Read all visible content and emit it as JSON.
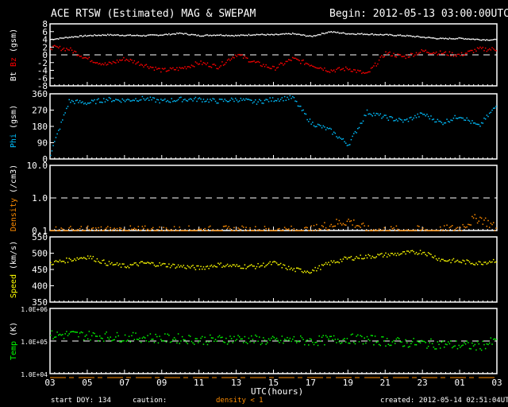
{
  "header": {
    "title": "ACE RTSW (Estimated) MAG & SWEPAM",
    "begin": "Begin: 2012-05-13 03:00:00UTC"
  },
  "footer": {
    "start_doy": "start DOY: 134",
    "caution": "caution:",
    "density_note": "density < 1",
    "created": "created: 2012-05-14 02:51:04UTC",
    "xlabel": "UTC(hours)"
  },
  "colors": {
    "bt": "#ffffff",
    "bz": "#ff0000",
    "phi": "#00bfff",
    "density": "#ff8c00",
    "speed": "#ffff00",
    "temp": "#00ff00"
  },
  "chart_data": {
    "type": "scatter",
    "x_hours_from_start": [
      0,
      1,
      2,
      3,
      4,
      5,
      6,
      7,
      8,
      9,
      10,
      11,
      12,
      13,
      14,
      15,
      16,
      17,
      18,
      19,
      20,
      21,
      22,
      23,
      24
    ],
    "xticks": [
      "03",
      "05",
      "07",
      "09",
      "11",
      "13",
      "15",
      "17",
      "19",
      "21",
      "23",
      "01",
      "03"
    ],
    "panels": [
      {
        "name": "bt-bz",
        "ylabel_parts": [
          "Bt",
          "Bz",
          "(gsm)"
        ],
        "ylim": [
          -8,
          8
        ],
        "scale": "linear",
        "yticks": [
          "8",
          "6",
          "4",
          "2",
          "0",
          "-2",
          "-4",
          "-6",
          "-8"
        ],
        "reference": 0,
        "series": [
          {
            "name": "Bt",
            "color": "#ffffff",
            "values": [
              4,
              4.6,
              5,
              5.2,
              5.1,
              5,
              5.2,
              5.6,
              5,
              5.2,
              5,
              5.3,
              5.2,
              5.5,
              4.8,
              6,
              5.5,
              5.4,
              5.2,
              5,
              4.6,
              4.2,
              4.3,
              4,
              3.9
            ]
          },
          {
            "name": "Bz",
            "color": "#ff0000",
            "values": [
              2,
              1.5,
              -1,
              -2.5,
              -1,
              -2.5,
              -4,
              -3.5,
              -2,
              -3,
              0.2,
              -2,
              -3.5,
              -1,
              -2.5,
              -4,
              -3.5,
              -5,
              0.5,
              -0.5,
              1,
              0.5,
              0,
              1.5,
              1.5
            ]
          }
        ]
      },
      {
        "name": "phi",
        "ylabel_parts": [
          "Phi",
          "(gsm)"
        ],
        "ylim": [
          0,
          360
        ],
        "scale": "linear",
        "yticks": [
          "360",
          "270",
          "180",
          "90",
          "0"
        ],
        "series": [
          {
            "name": "Phi",
            "color": "#00bfff",
            "values": [
              30,
              320,
              310,
              330,
              325,
              335,
              320,
              330,
              330,
              320,
              330,
              315,
              330,
              340,
              200,
              160,
              80,
              260,
              230,
              210,
              250,
              200,
              240,
              180,
              300
            ]
          }
        ]
      },
      {
        "name": "density",
        "ylabel_parts": [
          "Density",
          "(/cm3)"
        ],
        "ylim": [
          0.1,
          10
        ],
        "scale": "log",
        "yticks": [
          "10.0",
          "1.0",
          "0.1"
        ],
        "reference": 1,
        "series": [
          {
            "name": "Density",
            "color": "#ff8c00",
            "values": [
              0.1,
              0.1,
              0.1,
              0.1,
              0.1,
              0.1,
              0.1,
              0.1,
              0.1,
              0.1,
              0.1,
              0.1,
              0.1,
              0.1,
              0.1,
              0.15,
              0.2,
              0.1,
              0.1,
              0.1,
              0.1,
              0.1,
              0.12,
              0.25,
              0.1
            ]
          }
        ]
      },
      {
        "name": "speed",
        "ylabel_parts": [
          "Speed",
          "(km/s)"
        ],
        "ylim": [
          350,
          550
        ],
        "scale": "linear",
        "yticks": [
          "550",
          "500",
          "450",
          "400",
          "350"
        ],
        "series": [
          {
            "name": "Speed",
            "color": "#ffff00",
            "values": [
              470,
              480,
              490,
              470,
              460,
              470,
              465,
              460,
              455,
              465,
              460,
              460,
              470,
              450,
              445,
              470,
              485,
              490,
              495,
              500,
              505,
              480,
              475,
              470,
              480
            ]
          }
        ]
      },
      {
        "name": "temp",
        "ylabel_parts": [
          "Temp",
          "(K)"
        ],
        "ylim": [
          10000,
          1000000
        ],
        "scale": "log",
        "yticks": [
          "1.0E+06",
          "1.0E+05",
          "1.0E+04"
        ],
        "reference": 100000,
        "series": [
          {
            "name": "Temp",
            "color": "#00ff00",
            "values": [
              150000,
              160000,
              150000,
              140000,
              130000,
              130000,
              120000,
              120000,
              110000,
              110000,
              120000,
              110000,
              100000,
              110000,
              100000,
              110000,
              120000,
              110000,
              100000,
              90000,
              85000,
              80000,
              75000,
              70000,
              100000
            ]
          }
        ]
      }
    ]
  }
}
